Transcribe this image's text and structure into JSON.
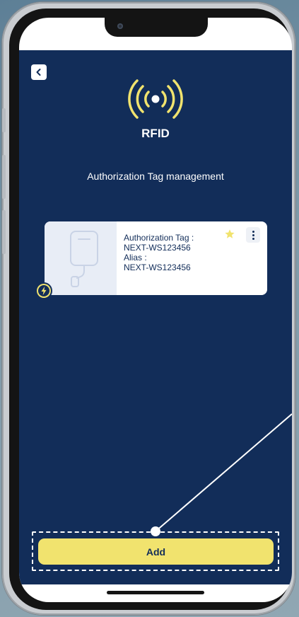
{
  "header": {
    "back_icon": "chevron-left-icon",
    "feature_icon": "rfid-signal-icon",
    "title": "RFID",
    "subtitle": "Authorization Tag management"
  },
  "tags": [
    {
      "tag_label": "Authorization Tag :",
      "tag_value": "NEXT-WS123456",
      "alias_label": "Alias :",
      "alias_value": "NEXT-WS123456",
      "favorite": true,
      "image_icon": "charger-illustration",
      "badge_icon": "lightning-bolt-icon"
    }
  ],
  "actions": {
    "add_label": "Add"
  },
  "colors": {
    "background": "#122d59",
    "accent": "#f1e36e",
    "text_light": "#ffffff",
    "card": "#ffffff"
  }
}
